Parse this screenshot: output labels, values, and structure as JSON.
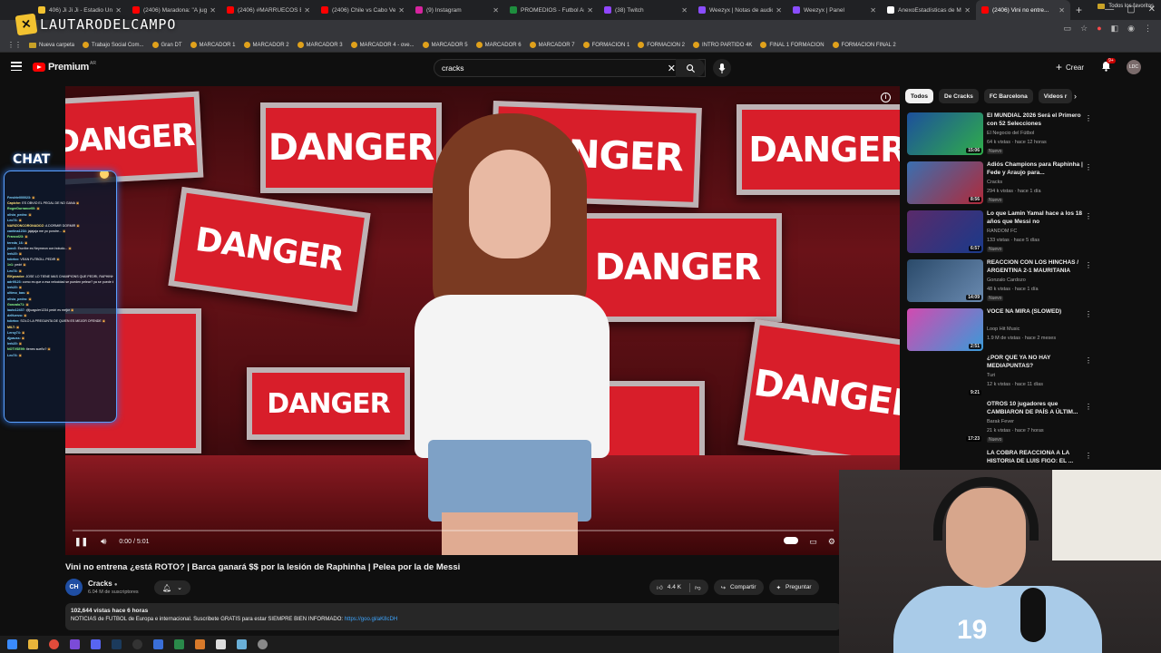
{
  "browser": {
    "tabs": [
      {
        "label": "406) Ji Ji Ji - Estadio Úni...",
        "color": "#f2c230",
        "active": false
      },
      {
        "label": "(2406) Maradona: \"A jugar",
        "color": "#ff0000",
        "active": false
      },
      {
        "label": "(2406) #MARRUECOS EN",
        "color": "#ff0000",
        "active": false
      },
      {
        "label": "(2406) Chile vs Cabo Verde",
        "color": "#ff0000",
        "active": false
      },
      {
        "label": "(9) Instagram",
        "color": "#d6249f",
        "active": false
      },
      {
        "label": "PROMEDIOS - Futbol Arg...",
        "color": "#1e8e3e",
        "active": false
      },
      {
        "label": "(38) Twitch",
        "color": "#9146ff",
        "active": false
      },
      {
        "label": "Weezyx | Notas de audio",
        "color": "#8a4dff",
        "active": false
      },
      {
        "label": "Weezyx | Panel",
        "color": "#8a4dff",
        "active": false
      },
      {
        "label": "AnexoEstadísticas de Mi...",
        "color": "#ffffff",
        "active": false
      },
      {
        "label": "(2406) Vini no entre...",
        "color": "#ff0000",
        "active": true
      }
    ],
    "bookmarks": [
      {
        "label": "Nueva carpeta",
        "type": "folder"
      },
      {
        "label": "Trabajo Social Com...",
        "type": "site"
      },
      {
        "label": "Gran DT",
        "type": "site"
      },
      {
        "label": "MARCADOR 1",
        "type": "site"
      },
      {
        "label": "MARCADOR 2",
        "type": "site"
      },
      {
        "label": "MARCADOR 3",
        "type": "site"
      },
      {
        "label": "MARCADOR 4 - ove...",
        "type": "site"
      },
      {
        "label": "MARCADOR 5",
        "type": "site"
      },
      {
        "label": "MARCADOR 6",
        "type": "site"
      },
      {
        "label": "MARCADOR 7",
        "type": "site"
      },
      {
        "label": "FORMACION 1",
        "type": "site"
      },
      {
        "label": "FORMACION 2",
        "type": "site"
      },
      {
        "label": "INTRO PARTIDO 4K",
        "type": "site"
      },
      {
        "label": "FINAL 1 FORMACION",
        "type": "site"
      },
      {
        "label": "FORMACION FINAL 2",
        "type": "site"
      }
    ],
    "bookmarks_right": "Todos los favoritos"
  },
  "overlay": {
    "streamer_name": "LAUTARODELCAMPO",
    "chat_title": "CHAT",
    "chat_lines": [
      {
        "user": "Fendrie000023:",
        "msg": "",
        "c": ""
      },
      {
        "user": "Capiche:",
        "msg": "ES OBVIO EL PEGAL DE NO GANA",
        "c": "y"
      },
      {
        "user": "RogerDurrance00:",
        "msg": "",
        "c": "g"
      },
      {
        "user": "olivia_pedro:",
        "msg": "",
        "c": ""
      },
      {
        "user": "Leo74:",
        "msg": "",
        "c": ""
      },
      {
        "user": "NARIZONCORONADOZ:",
        "msg": "A DORMIR DORMIR",
        "c": "y"
      },
      {
        "user": "cantina1234:",
        "msg": "jajajaja me yo pondre...",
        "c": ""
      },
      {
        "user": "Francol23:",
        "msg": "",
        "c": "g"
      },
      {
        "user": "tereda_16:",
        "msg": "",
        "c": ""
      },
      {
        "user": "jsoo3:",
        "msg": "Escribe es Neymeon con boludo...",
        "c": ""
      },
      {
        "user": "lerb20:",
        "msg": "",
        "c": ""
      },
      {
        "user": "tobrtxx:",
        "msg": "VEAN FUTBOLL PEDIR",
        "c": ""
      },
      {
        "user": "1v1:",
        "msg": "pedri",
        "c": "g"
      },
      {
        "user": "Leo74:",
        "msg": "",
        "c": ""
      },
      {
        "user": "ElKpoador:",
        "msg": "JOSE LO TIENE MAS CHAMPIONS QUE PEDRI, RAPHINHA Y LAMINE YAMAL",
        "c": "y"
      },
      {
        "user": "adri9123:",
        "msg": "como es que a esa velocidad se pueden pelear? ya se puede leer",
        "c": ""
      },
      {
        "user": "lerb20:",
        "msg": "",
        "c": ""
      },
      {
        "user": "ultimo_bas:",
        "msg": "",
        "c": ""
      },
      {
        "user": "olivia_pedro:",
        "msg": "",
        "c": ""
      },
      {
        "user": "Gonzalo71:",
        "msg": "",
        "c": "g"
      },
      {
        "user": "lauto12437:",
        "msg": "@juaguler1234 pedri es mejor",
        "c": ""
      },
      {
        "user": "delfuerzo:",
        "msg": "",
        "c": ""
      },
      {
        "user": "tobrtxx:",
        "msg": "SOLO LA PREGUNTA DE QUIEN ES MEJOR OFENDE",
        "c": ""
      },
      {
        "user": "MILT:",
        "msg": "",
        "c": "y"
      },
      {
        "user": "Leroy74:",
        "msg": "",
        "c": ""
      },
      {
        "user": "djpauss:",
        "msg": "",
        "c": ""
      },
      {
        "user": "lerb20:",
        "msg": "",
        "c": ""
      },
      {
        "user": "NOTVSE99:",
        "msg": "tienes sueño?",
        "c": "g"
      },
      {
        "user": "Leo74:",
        "msg": "",
        "c": ""
      }
    ]
  },
  "youtube": {
    "logo_text": "Premium",
    "logo_cc": "AR",
    "search_value": "cracks",
    "create_label": "Crear",
    "notif_count": "9+",
    "avatar_initials": "LDC"
  },
  "video": {
    "sign_text": "DANGER",
    "time": "0:00 / 5:01",
    "title": "Vini no entrena ¿está ROTO? | Barca ganará $$ por la lesión de Raphinha | Pelea por la de Messi",
    "channel": "Cracks",
    "channel_initials": "CH",
    "subscribers": "6.04 M de suscriptores",
    "likes": "4.4 K",
    "share_label": "Compartir",
    "ask_label": "Preguntar",
    "meta": "102,644 vistas  hace 6 horas",
    "description": "NOTICIAS de FUTBOL de Europa e internacional. Suscribete GRATIS para estar SIEMPRE BIEN INFORMADO:",
    "link": "https://goo.gl/aK8cDH"
  },
  "sidebar": {
    "chips": [
      "Todos",
      "De Cracks",
      "FC Barcelona",
      "Videos r"
    ],
    "recommendations": [
      {
        "title": "El MUNDIAL 2026 Será el Primero con 52 Selecciones",
        "channel": "El Negocio del Fútbol",
        "stats": "64 k vistas · hace 12 horas",
        "duration": "15:06",
        "badge": "Nuevo",
        "c1": "#1d4f9c",
        "c2": "#2fae4a"
      },
      {
        "title": "Adiós Champions para Raphinha | Fede y Araujo para...",
        "channel": "Cracks",
        "stats": "294 k vistas · hace 1 día",
        "duration": "8:56",
        "badge": "Nuevo",
        "c1": "#3a6fb0",
        "c2": "#b02a3a"
      },
      {
        "title": "Lo que Lamin Yamal hace a los 18 años que Messi no",
        "channel": "RANDOM FC",
        "stats": "133 vistas · hace 5 días",
        "duration": "6:57",
        "badge": "Nuevo",
        "c1": "#5a2a6a",
        "c2": "#1a3a8a"
      },
      {
        "title": "REACCIÓN CON LOS HINCHAS / ARGENTINA 2-1 MAURITANIA",
        "channel": "Gonzalo Cardozo",
        "stats": "48 k vistas · hace 1 día",
        "duration": "14:09",
        "badge": "Nuevo",
        "c1": "#2a4a6a",
        "c2": "#6a8ab0"
      },
      {
        "title": "VOCE NA MIRA (SLOWED)",
        "channel": "Loop Hit Music",
        "stats": "1.9 M de vistas · hace 2 meses",
        "duration": "2:51",
        "badge": "",
        "c1": "#d24ab0",
        "c2": "#3a9ad8"
      },
      {
        "title": "¿POR QUÉ YA NO HAY MEDIAPUNTAS?",
        "channel": "Turi",
        "stats": "12 k vistas · hace 11 días",
        "duration": "9:21",
        "badge": "",
        "c1": "#0f0f0f",
        "c2": "#0f0f0f"
      },
      {
        "title": "OTROS 10 jugadores que CAMBIARON DE PAÍS A ÚLTIM...",
        "channel": "Barak Fever",
        "stats": "21 k vistas · hace 7 horas",
        "duration": "17:23",
        "badge": "Nuevo",
        "c1": "#0f0f0f",
        "c2": "#0f0f0f"
      },
      {
        "title": "LA COBRA REACCIONA A LA HISTORIA DE LUIS FIGO: EL ...",
        "channel": "",
        "stats": "",
        "duration": "",
        "badge": "",
        "c1": "#0f0f0f",
        "c2": "#0f0f0f"
      }
    ]
  },
  "webcam": {
    "jersey_number": "19"
  }
}
